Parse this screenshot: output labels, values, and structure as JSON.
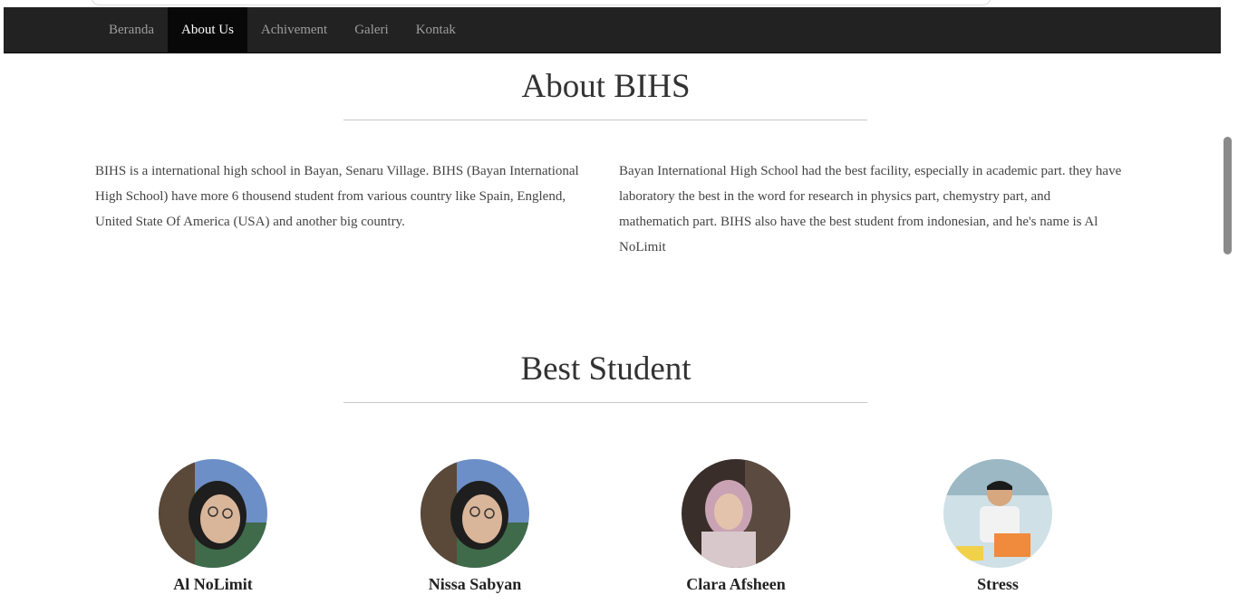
{
  "nav": {
    "items": [
      {
        "label": "Beranda",
        "active": false
      },
      {
        "label": "About Us",
        "active": true
      },
      {
        "label": "Achivement",
        "active": false
      },
      {
        "label": "Galeri",
        "active": false
      },
      {
        "label": "Kontak",
        "active": false
      }
    ]
  },
  "about": {
    "title": "About BIHS",
    "left_paragraph": "BIHS is a international high school in Bayan, Senaru Village. BIHS (Bayan International High School) have more 6 thousend student from various country like Spain, Englend, United State Of America (USA) and another big country.",
    "right_paragraph": "Bayan International High School had the best facility, especially in academic part. they have laboratory the best in the word for research in physics part, chemystry part, and mathematich part. BIHS also have the best student from indonesian, and he's name is Al NoLimit"
  },
  "best_students": {
    "title": "Best Student",
    "students": [
      {
        "name": "Al NoLimit"
      },
      {
        "name": "Nissa Sabyan"
      },
      {
        "name": "Clara Afsheen"
      },
      {
        "name": "Stress"
      }
    ]
  },
  "colors": {
    "navbar_bg": "#222222",
    "nav_active_bg": "#080808",
    "nav_text": "#9d9d9d",
    "nav_active_text": "#ffffff"
  }
}
